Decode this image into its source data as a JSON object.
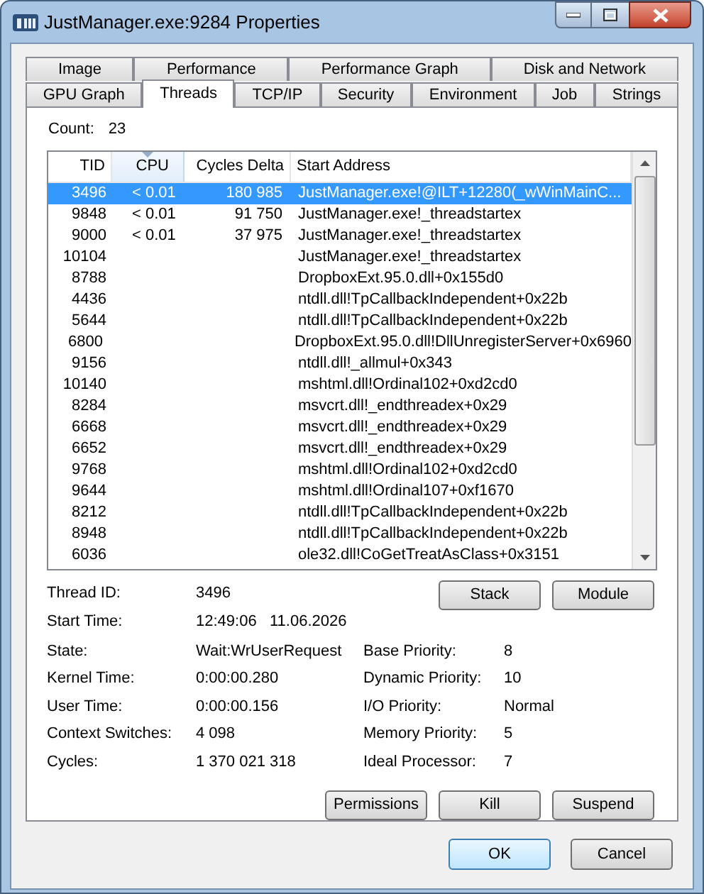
{
  "window": {
    "title": "JustManager.exe:9284 Properties"
  },
  "tab_rows": [
    [
      {
        "label": "Image",
        "selected": false
      },
      {
        "label": "Performance",
        "selected": false
      },
      {
        "label": "Performance Graph",
        "selected": false
      },
      {
        "label": "Disk and Network",
        "selected": false
      }
    ],
    [
      {
        "label": "GPU Graph",
        "selected": false
      },
      {
        "label": "Threads",
        "selected": true
      },
      {
        "label": "TCP/IP",
        "selected": false
      },
      {
        "label": "Security",
        "selected": false
      },
      {
        "label": "Environment",
        "selected": false
      },
      {
        "label": "Job",
        "selected": false
      },
      {
        "label": "Strings",
        "selected": false
      }
    ]
  ],
  "count": {
    "label": "Count:",
    "value": "23"
  },
  "table": {
    "columns": [
      {
        "label": "TID",
        "sorted": false
      },
      {
        "label": "CPU",
        "sorted": true
      },
      {
        "label": "Cycles Delta",
        "sorted": false
      },
      {
        "label": "Start Address",
        "sorted": false
      }
    ],
    "rows": [
      {
        "tid": "3496",
        "cpu": "< 0.01",
        "cycles": "180 985",
        "address": "JustManager.exe!@ILT+12280(_wWinMainC...",
        "selected": true
      },
      {
        "tid": "9848",
        "cpu": "< 0.01",
        "cycles": "91 750",
        "address": "JustManager.exe!_threadstartex",
        "selected": false
      },
      {
        "tid": "9000",
        "cpu": "< 0.01",
        "cycles": "37 975",
        "address": "JustManager.exe!_threadstartex",
        "selected": false
      },
      {
        "tid": "10104",
        "address": "JustManager.exe!_threadstartex",
        "selected": false
      },
      {
        "tid": "8788",
        "address": "DropboxExt.95.0.dll+0x155d0",
        "selected": false
      },
      {
        "tid": "4436",
        "address": "ntdll.dll!TpCallbackIndependent+0x22b",
        "selected": false
      },
      {
        "tid": "5644",
        "address": "ntdll.dll!TpCallbackIndependent+0x22b",
        "selected": false
      },
      {
        "tid": "6800",
        "address": "DropboxExt.95.0.dll!DllUnregisterServer+0x6960",
        "selected": false
      },
      {
        "tid": "9156",
        "address": "ntdll.dll!_allmul+0x343",
        "selected": false
      },
      {
        "tid": "10140",
        "address": "mshtml.dll!Ordinal102+0xd2cd0",
        "selected": false
      },
      {
        "tid": "8284",
        "address": "msvcrt.dll!_endthreadex+0x29",
        "selected": false
      },
      {
        "tid": "6668",
        "address": "msvcrt.dll!_endthreadex+0x29",
        "selected": false
      },
      {
        "tid": "6652",
        "address": "msvcrt.dll!_endthreadex+0x29",
        "selected": false
      },
      {
        "tid": "9768",
        "address": "mshtml.dll!Ordinal102+0xd2cd0",
        "selected": false
      },
      {
        "tid": "9644",
        "address": "mshtml.dll!Ordinal107+0xf1670",
        "selected": false
      },
      {
        "tid": "8212",
        "address": "ntdll.dll!TpCallbackIndependent+0x22b",
        "selected": false
      },
      {
        "tid": "8948",
        "address": "ntdll.dll!TpCallbackIndependent+0x22b",
        "selected": false
      },
      {
        "tid": "6036",
        "address": "ole32.dll!CoGetTreatAsClass+0x3151",
        "selected": false
      }
    ]
  },
  "details_top": [
    {
      "label": "Thread ID:",
      "value": "3496"
    },
    {
      "label": "Start Time:",
      "value": "12:49:06   11.06.2026"
    }
  ],
  "details_left": [
    {
      "label": "State:",
      "value": "Wait:WrUserRequest"
    },
    {
      "label": "Kernel Time:",
      "value": "0:00:00.280"
    },
    {
      "label": "User Time:",
      "value": "0:00:00.156"
    },
    {
      "label": "Context Switches:",
      "value": "4 098"
    },
    {
      "label": "Cycles:",
      "value": "1 370 021 318"
    }
  ],
  "details_right": [
    {
      "label": "Base Priority:",
      "value": "8"
    },
    {
      "label": "Dynamic Priority:",
      "value": "10"
    },
    {
      "label": "I/O Priority:",
      "value": "Normal"
    },
    {
      "label": "Memory Priority:",
      "value": "5"
    },
    {
      "label": "Ideal Processor:",
      "value": "7"
    }
  ],
  "top_buttons": [
    "Stack",
    "Module"
  ],
  "bottom_buttons": [
    "Permissions",
    "Kill",
    "Suspend"
  ],
  "dialog_buttons": [
    {
      "label": "OK",
      "default": true
    },
    {
      "label": "Cancel",
      "default": false
    }
  ]
}
